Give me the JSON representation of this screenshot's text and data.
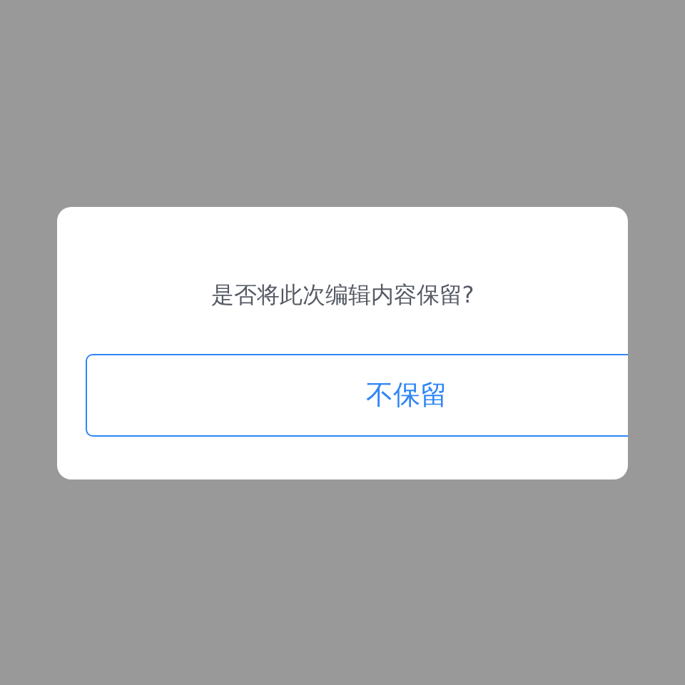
{
  "dialog": {
    "message": "是否将此次编辑内容保留?",
    "buttons": [
      {
        "label": "不保留"
      }
    ]
  }
}
